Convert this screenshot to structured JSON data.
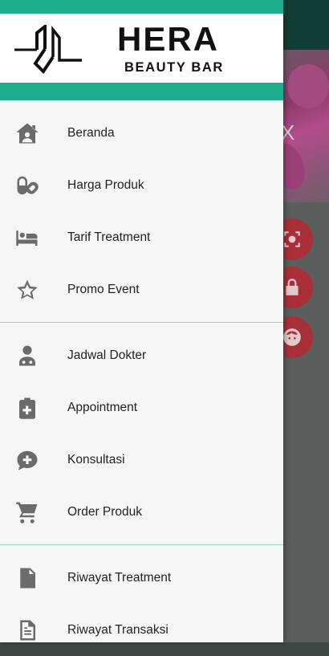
{
  "brand": {
    "title": "HERA",
    "subtitle": "BEAUTY BAR",
    "accent_color": "#1cae8d"
  },
  "background": {
    "close_glyph": "X",
    "fabs": [
      {
        "icon": "scan-face-icon",
        "color": "#a82f37"
      },
      {
        "icon": "lock-icon",
        "color": "#a82f37"
      },
      {
        "icon": "face-icon",
        "color": "#a82f37"
      }
    ]
  },
  "menu": {
    "group1": [
      {
        "label": "Beranda",
        "icon": "home-icon"
      },
      {
        "label": "Harga Produk",
        "icon": "pills-icon"
      },
      {
        "label": "Tarif Treatment",
        "icon": "bed-icon"
      },
      {
        "label": "Promo Event",
        "icon": "star-icon"
      }
    ],
    "group2": [
      {
        "label": "Jadwal Dokter",
        "icon": "doctor-icon"
      },
      {
        "label": "Appointment",
        "icon": "clipboard-plus-icon"
      },
      {
        "label": "Konsultasi",
        "icon": "chat-plus-icon"
      },
      {
        "label": "Order Produk",
        "icon": "cart-icon"
      }
    ],
    "group3": [
      {
        "label": "Riwayat Treatment",
        "icon": "file-pulse-icon"
      },
      {
        "label": "Riwayat Transaksi",
        "icon": "file-text-icon"
      }
    ]
  }
}
